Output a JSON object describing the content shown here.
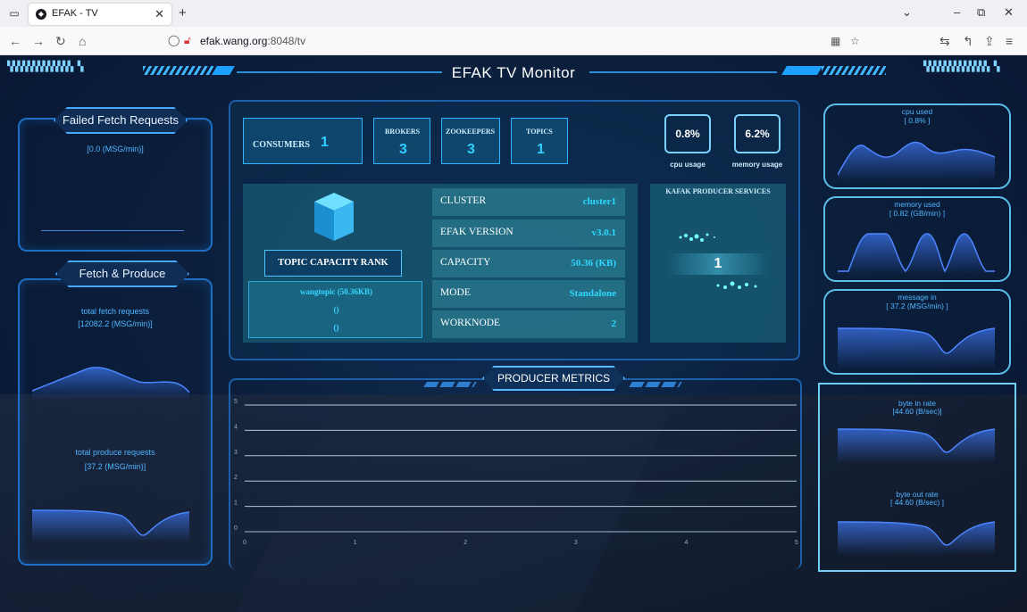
{
  "browser": {
    "tab_title": "EFAK - TV",
    "url_host": "efak.wang.org",
    "url_port_path": ":8048/tv"
  },
  "dashboard": {
    "title": "EFAK  TV  Monitor",
    "left": {
      "failed_title": "Failed Fetch Requests",
      "failed_value": "[0.0 (MSG/min)]",
      "fetch_produce_title": "Fetch & Produce",
      "total_fetch_label": "total fetch requests",
      "total_fetch_value": "[12082.2 (MSG/min)]",
      "total_produce_label": "total produce requests",
      "total_produce_value": "[37.2 (MSG/min)]"
    },
    "stats": {
      "consumers_label": "CONSUMERS",
      "consumers_value": "1",
      "brokers_label": "BROKERS",
      "brokers_value": "3",
      "zookeepers_label": "ZOOKEEPERS",
      "zookeepers_value": "3",
      "topics_label": "TOPICS",
      "topics_value": "1",
      "cpu_usage_value": "0.8%",
      "cpu_usage_label": "cpu usage",
      "memory_usage_value": "6.2%",
      "memory_usage_label": "memory usage"
    },
    "rank": {
      "button": "TOPIC CAPACITY RANK",
      "items": [
        "wangtopic (50.36KB)",
        "()",
        "()"
      ]
    },
    "info": [
      {
        "key": "CLUSTER",
        "value": "cluster1"
      },
      {
        "key": "EFAK VERSION",
        "value": "v3.0.1"
      },
      {
        "key": "CAPACITY",
        "value": "50.36 (KB)"
      },
      {
        "key": "MODE",
        "value": "Standalone"
      },
      {
        "key": "WORKNODE",
        "value": "2"
      }
    ],
    "producer": {
      "title": "KAFAK PRODUCER SERVICES",
      "value": "1"
    },
    "metrics": {
      "title": "PRODUCER METRICS"
    },
    "right": {
      "cpu_used_label": "cpu used",
      "cpu_used_value": "[ 0.8% ]",
      "memory_used_label": "memory used",
      "memory_used_value": "[ 0.82 (GB/min) ]",
      "message_in_label": "message in",
      "message_in_value": "[ 37.2 (MSG/min) ]",
      "byte_in_label": "byte in rate",
      "byte_in_value": "[44.60 (B/sec)]",
      "byte_out_label": "byte out rate",
      "byte_out_value": "[ 44.60 (B/sec) ]"
    }
  },
  "chart_data": {
    "type": "line",
    "title": "PRODUCER METRICS",
    "x": [
      0,
      1,
      2,
      3,
      4,
      5
    ],
    "xlim": [
      0,
      5
    ],
    "ylim": [
      0,
      5
    ],
    "y_ticks": [
      "0",
      "1",
      "2",
      "3",
      "4",
      "5"
    ],
    "x_ticks": [
      "0",
      "1",
      "2",
      "3",
      "4",
      "5"
    ],
    "series": [],
    "grid": true
  }
}
